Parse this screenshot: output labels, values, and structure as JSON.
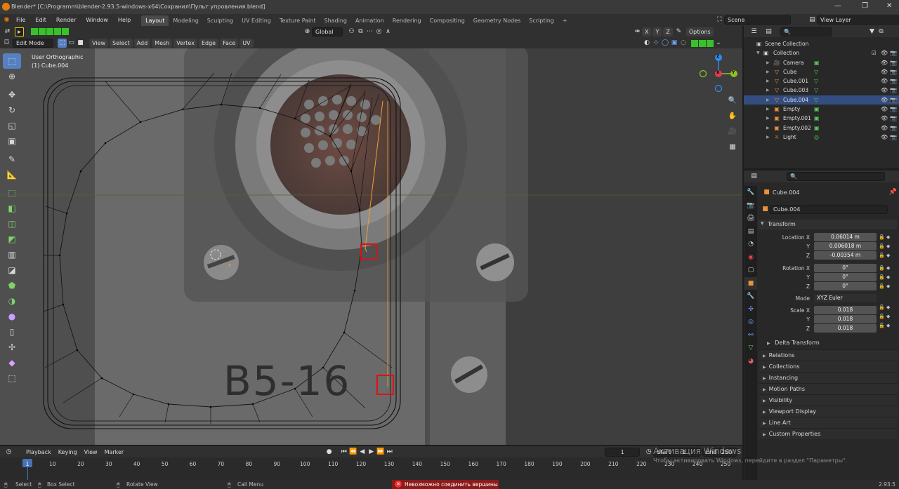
{
  "window": {
    "title": "Blender* [C:\\Programm\\blender-2.93.5-windows-x64\\Сохранил\\Пульт упровления.blend]"
  },
  "menu": {
    "items": [
      "File",
      "Edit",
      "Render",
      "Window",
      "Help"
    ],
    "workspaces": [
      "Layout",
      "Modeling",
      "Sculpting",
      "UV Editing",
      "Texture Paint",
      "Shading",
      "Animation",
      "Rendering",
      "Compositing",
      "Geometry Nodes",
      "Scripting"
    ],
    "active_workspace": "Layout",
    "add_tab": "+",
    "scene": "Scene",
    "view_layer": "View Layer"
  },
  "viewport_header": {
    "orientation": "Global",
    "options": "Options",
    "axes": [
      "X",
      "Y",
      "Z"
    ]
  },
  "viewport_menu": {
    "mode": "Edit Mode",
    "items": [
      "View",
      "Select",
      "Add",
      "Mesh",
      "Vertex",
      "Edge",
      "Face",
      "UV"
    ]
  },
  "viewport_overlay": {
    "view_name": "User Orthographic",
    "object_name": "(1) Cube.004",
    "plate_text": "B5-16",
    "gizmo": {
      "x": "X",
      "y": "Y",
      "z": "Z"
    }
  },
  "outliner": {
    "scene_collection": "Scene Collection",
    "collection": "Collection",
    "items": [
      {
        "name": "Camera",
        "type": "camera-icon"
      },
      {
        "name": "Cube",
        "type": "mesh-icon"
      },
      {
        "name": "Cube.001",
        "type": "mesh-icon"
      },
      {
        "name": "Cube.003",
        "type": "mesh-icon"
      },
      {
        "name": "Cube.004",
        "type": "mesh-icon",
        "selected": true
      },
      {
        "name": "Empty",
        "type": "image-empty-icon"
      },
      {
        "name": "Empty.001",
        "type": "image-empty-icon"
      },
      {
        "name": "Empty.002",
        "type": "image-empty-icon"
      },
      {
        "name": "Light",
        "type": "light-icon"
      }
    ]
  },
  "properties": {
    "object_name": "Cube.004",
    "data_name": "Cube.004",
    "transform_title": "Transform",
    "location": {
      "label": "Location X",
      "y_label": "Y",
      "z_label": "Z",
      "x": "0.06014 m",
      "y": "0.006018 m",
      "z": "-0.00354 m"
    },
    "rotation": {
      "label": "Rotation X",
      "y_label": "Y",
      "z_label": "Z",
      "x": "0°",
      "y": "0°",
      "z": "0°"
    },
    "mode": {
      "label": "Mode",
      "value": "XYZ Euler"
    },
    "scale": {
      "label": "Scale X",
      "y_label": "Y",
      "z_label": "Z",
      "x": "0.018",
      "y": "0.018",
      "z": "0.018"
    },
    "delta_transform": "Delta Transform",
    "panels": [
      "Relations",
      "Collections",
      "Instancing",
      "Motion Paths",
      "Visibility",
      "Viewport Display",
      "Line Art",
      "Custom Properties"
    ]
  },
  "timeline": {
    "menus": [
      "Playback",
      "Keying",
      "View",
      "Marker"
    ],
    "current_frame": "1",
    "start_label": "Start",
    "start": "1",
    "end_label": "End",
    "end": "250",
    "ticks": [
      "1",
      "10",
      "20",
      "30",
      "40",
      "50",
      "60",
      "70",
      "80",
      "90",
      "100",
      "110",
      "120",
      "130",
      "140",
      "150",
      "160",
      "170",
      "180",
      "190",
      "200",
      "210",
      "220",
      "230",
      "240",
      "250"
    ]
  },
  "watermark": {
    "line1": "Активация Windows",
    "line2": "Чтобы активировать Windows, перейдите в раздел \"Параметры\"."
  },
  "statusbar": {
    "select": "Select",
    "box_select": "Box Select",
    "rotate_view": "Rotate View",
    "call_menu": "Call Menu",
    "error": "Невозможно соединить вершины",
    "version": "2.93.5"
  },
  "colors": {
    "accent": "#e87d0d",
    "selection": "#334d80",
    "active_tool": "#5680c2",
    "error": "#c62828"
  }
}
